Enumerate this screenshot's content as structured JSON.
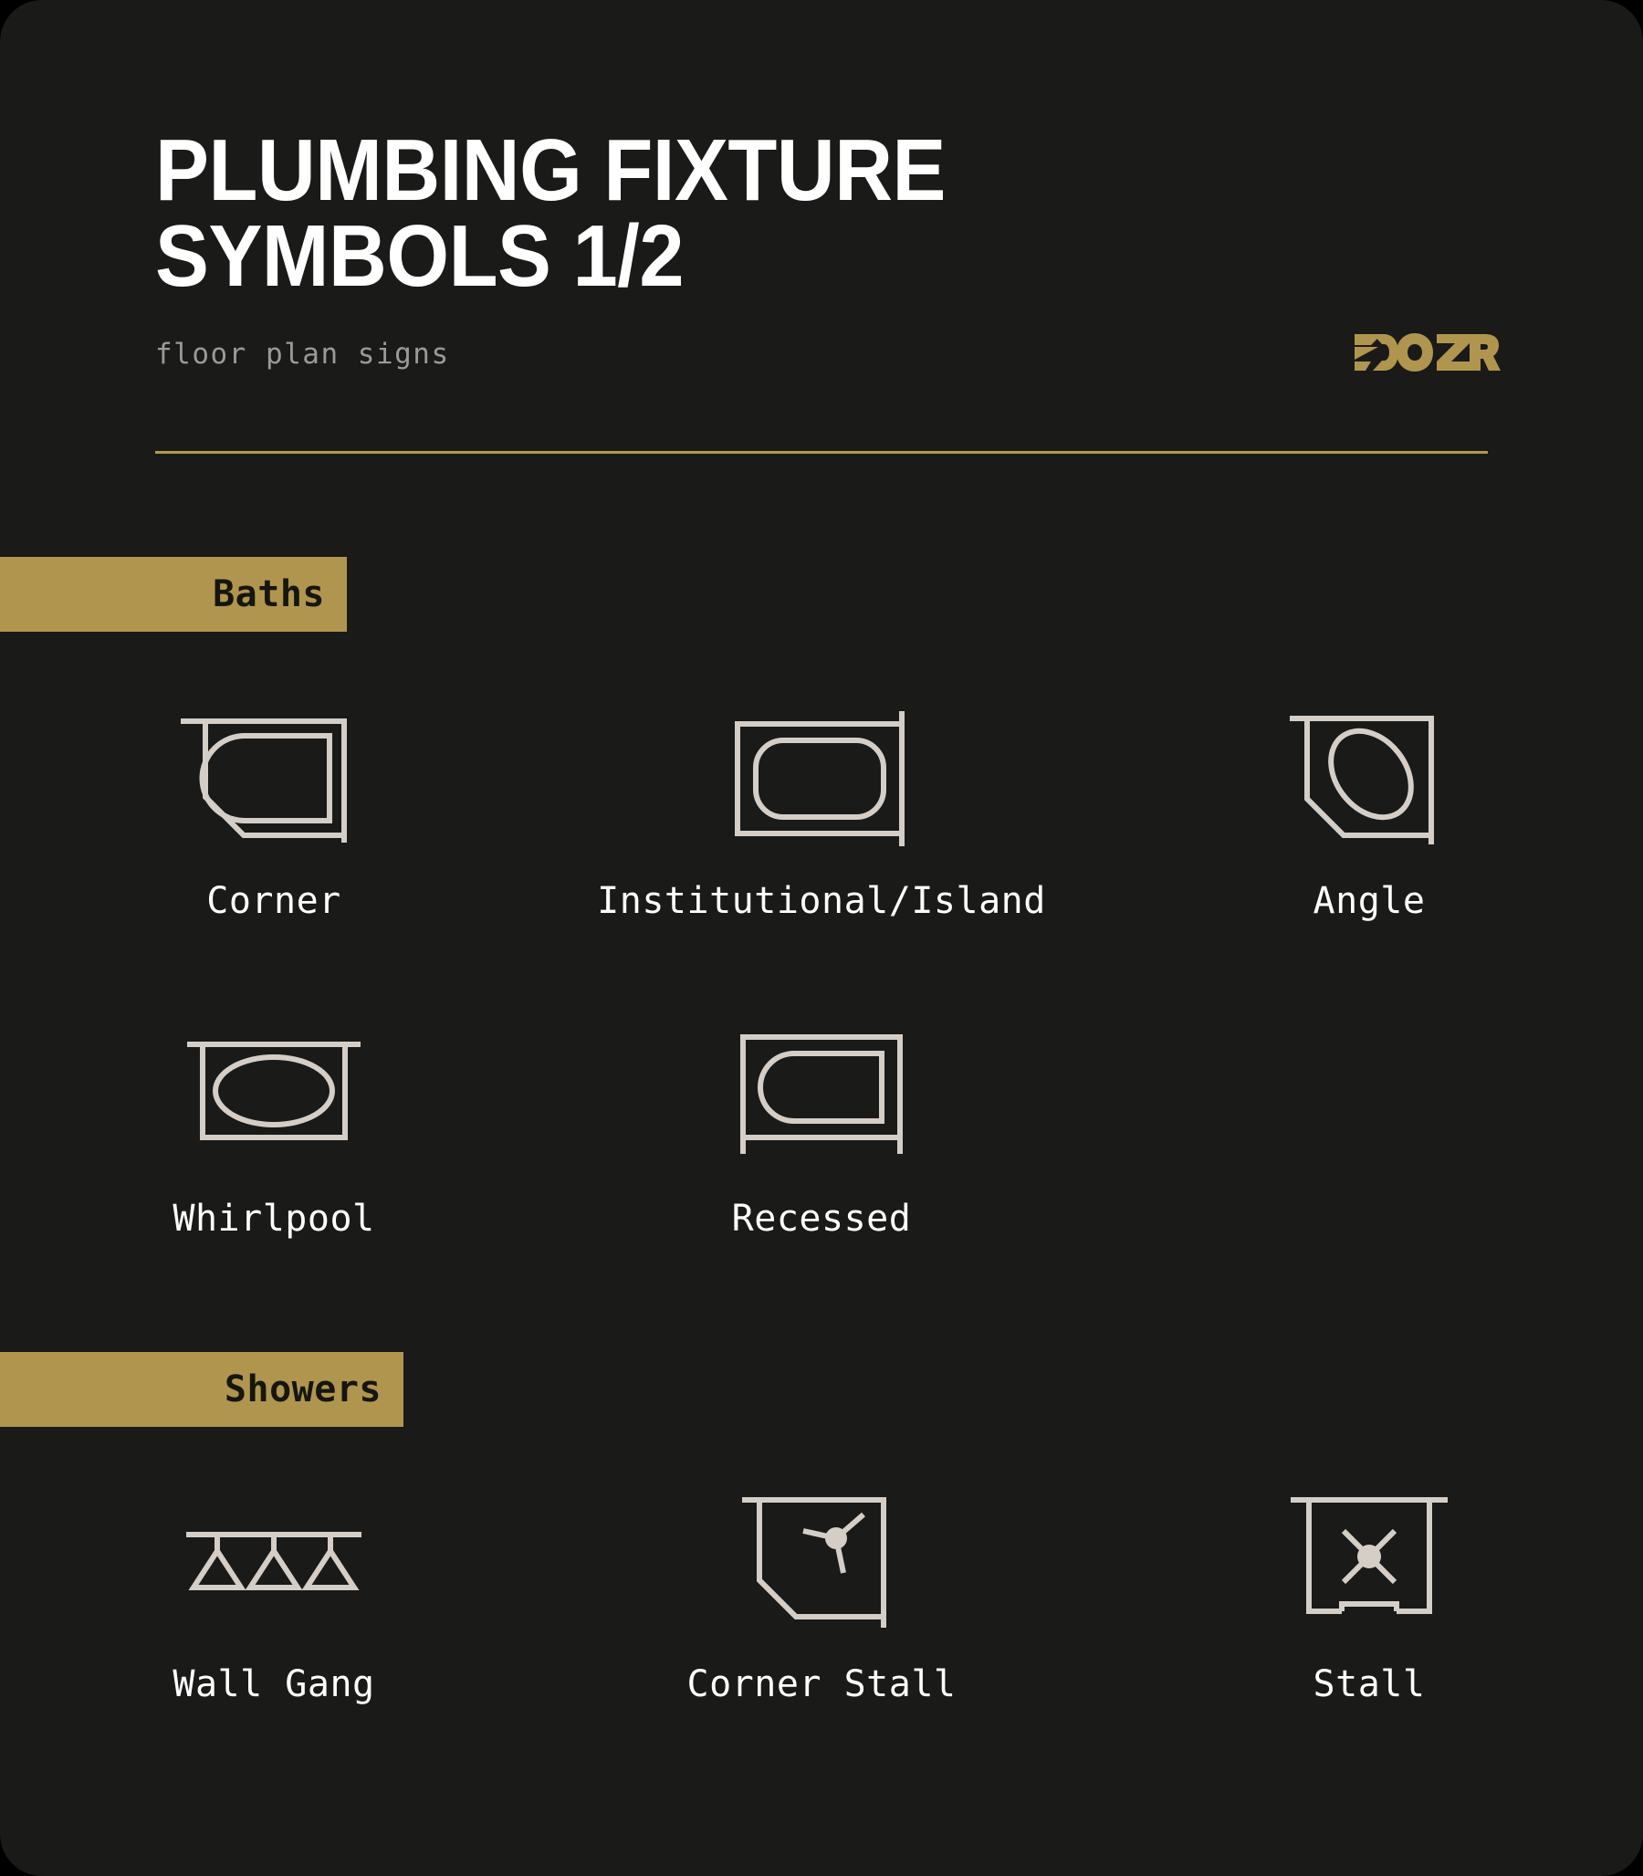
{
  "card": {
    "background_color": "#1a1a18",
    "accent_color": "#b0954f",
    "symbol_color": "#d4cec7"
  },
  "header": {
    "title": "PLUMBING FIXTURE\nSYMBOLS 1/2",
    "subtitle": "floor plan signs",
    "logo_text": "DOZR",
    "logo_color": "#b0954f"
  },
  "sections": [
    {
      "id": "baths",
      "label": "Baths",
      "rows": [
        [
          {
            "label": "Corner",
            "icon": "corner-bath-icon"
          },
          {
            "label": "Institutional/Island",
            "icon": "island-bath-icon"
          },
          {
            "label": "Angle",
            "icon": "angle-bath-icon"
          }
        ],
        [
          {
            "label": "Whirlpool",
            "icon": "whirlpool-bath-icon"
          },
          {
            "label": "Recessed",
            "icon": "recessed-bath-icon"
          },
          {
            "label": "",
            "icon": ""
          }
        ]
      ]
    },
    {
      "id": "showers",
      "label": "Showers",
      "rows": [
        [
          {
            "label": "Wall Gang",
            "icon": "wall-gang-shower-icon"
          },
          {
            "label": "Corner Stall",
            "icon": "corner-stall-shower-icon"
          },
          {
            "label": "Stall",
            "icon": "stall-shower-icon"
          }
        ]
      ]
    }
  ]
}
